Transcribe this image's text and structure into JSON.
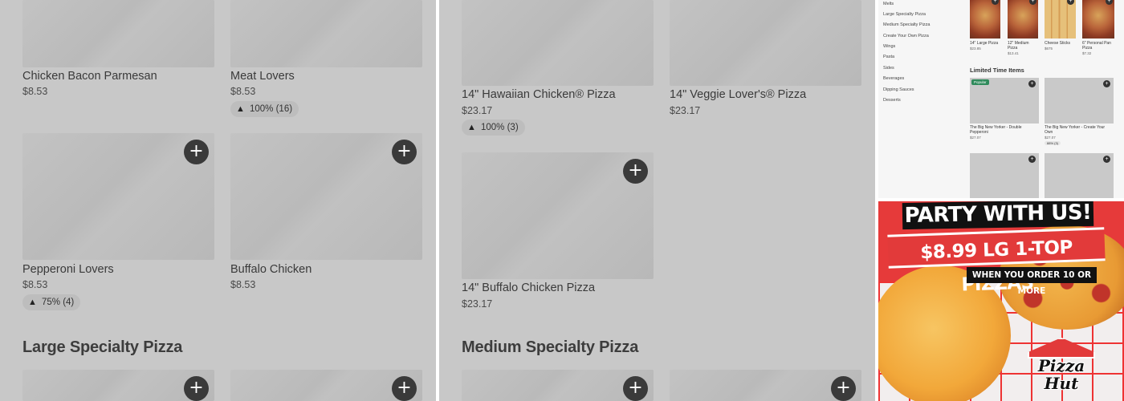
{
  "panel1": {
    "items": [
      {
        "name": "Chicken Bacon Parmesan",
        "price": "$8.53",
        "rating": ""
      },
      {
        "name": "Meat Lovers",
        "price": "$8.53",
        "rating": "100% (16)"
      },
      {
        "name": "Pepperoni Lovers",
        "price": "$8.53",
        "rating": "75% (4)"
      },
      {
        "name": "Buffalo Chicken",
        "price": "$8.53",
        "rating": ""
      }
    ],
    "section_title": "Large Specialty Pizza"
  },
  "panel2": {
    "items": [
      {
        "name": "14\" Hawaiian Chicken® Pizza",
        "price": "$23.17",
        "rating": "100% (3)"
      },
      {
        "name": "14\" Veggie Lover's® Pizza",
        "price": "$23.17",
        "rating": ""
      },
      {
        "name": "14\" Buffalo Chicken Pizza",
        "price": "$23.17",
        "rating": ""
      }
    ],
    "section_title": "Medium Specialty Pizza"
  },
  "panel3": {
    "nav": [
      "Melts",
      "Large Specialty Pizza",
      "Medium Specialty Pizza",
      "Create Your Own Pizza",
      "Wings",
      "Pasta",
      "Sides",
      "Beverages",
      "Dipping Sauces",
      "Desserts"
    ],
    "top_items": [
      {
        "name": "14\" Large Pizza",
        "price": "$23.85"
      },
      {
        "name": "12\" Medium Pizza",
        "price": "$13.41"
      },
      {
        "name": "Cheese Sticks",
        "price": "$675"
      },
      {
        "name": "6\" Personal Pan Pizza",
        "price": "$7.32"
      }
    ],
    "section_title": "Limited Time Items",
    "limited_items": [
      {
        "name": "The Big New Yorker - Double Pepperoni",
        "price": "$27.07",
        "badge": "Popular",
        "rating": ""
      },
      {
        "name": "The Big New Yorker - Create Your Own",
        "price": "$27.07",
        "badge": "",
        "rating": "88% (3)"
      }
    ]
  },
  "ad": {
    "headline": "PARTY WITH US!",
    "price_line": "$8.99 LG 1-TOP PIZZAS",
    "subline": "WHEN YOU ORDER 10 OR MORE",
    "logo_line1": "Pizza",
    "logo_line2": "Hut"
  },
  "icons": {
    "plus": "+",
    "thumb": "👍"
  }
}
